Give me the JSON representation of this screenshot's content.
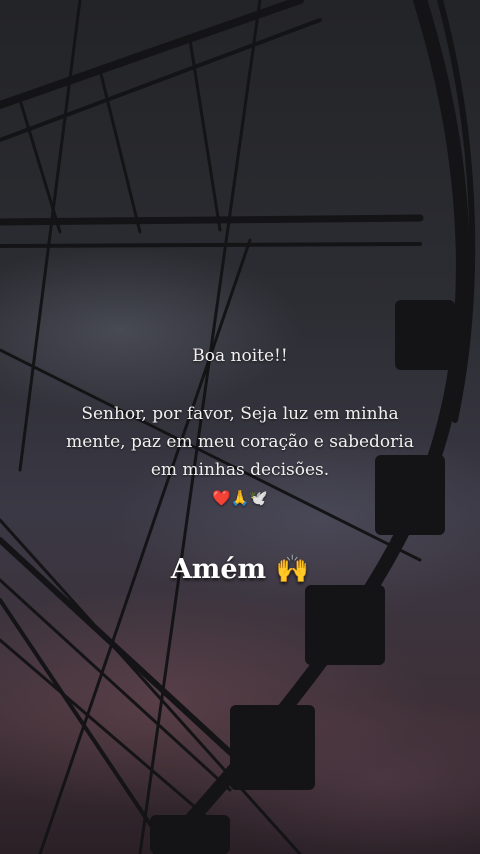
{
  "caption": {
    "greeting": "Boa noite!!",
    "prayer": "Senhor, por favor, Seja luz em minha mente, paz em meu coração e sabedoria em minhas decisões.",
    "emojis": "❤️🙏🕊️"
  },
  "amen": {
    "label": "Amém 🙌"
  },
  "scene": {
    "subject": "ferris-wheel silhouette",
    "colors": {
      "sky_top": "#232427",
      "sky_bottom": "#3e2f36",
      "structure": "#141417"
    }
  }
}
